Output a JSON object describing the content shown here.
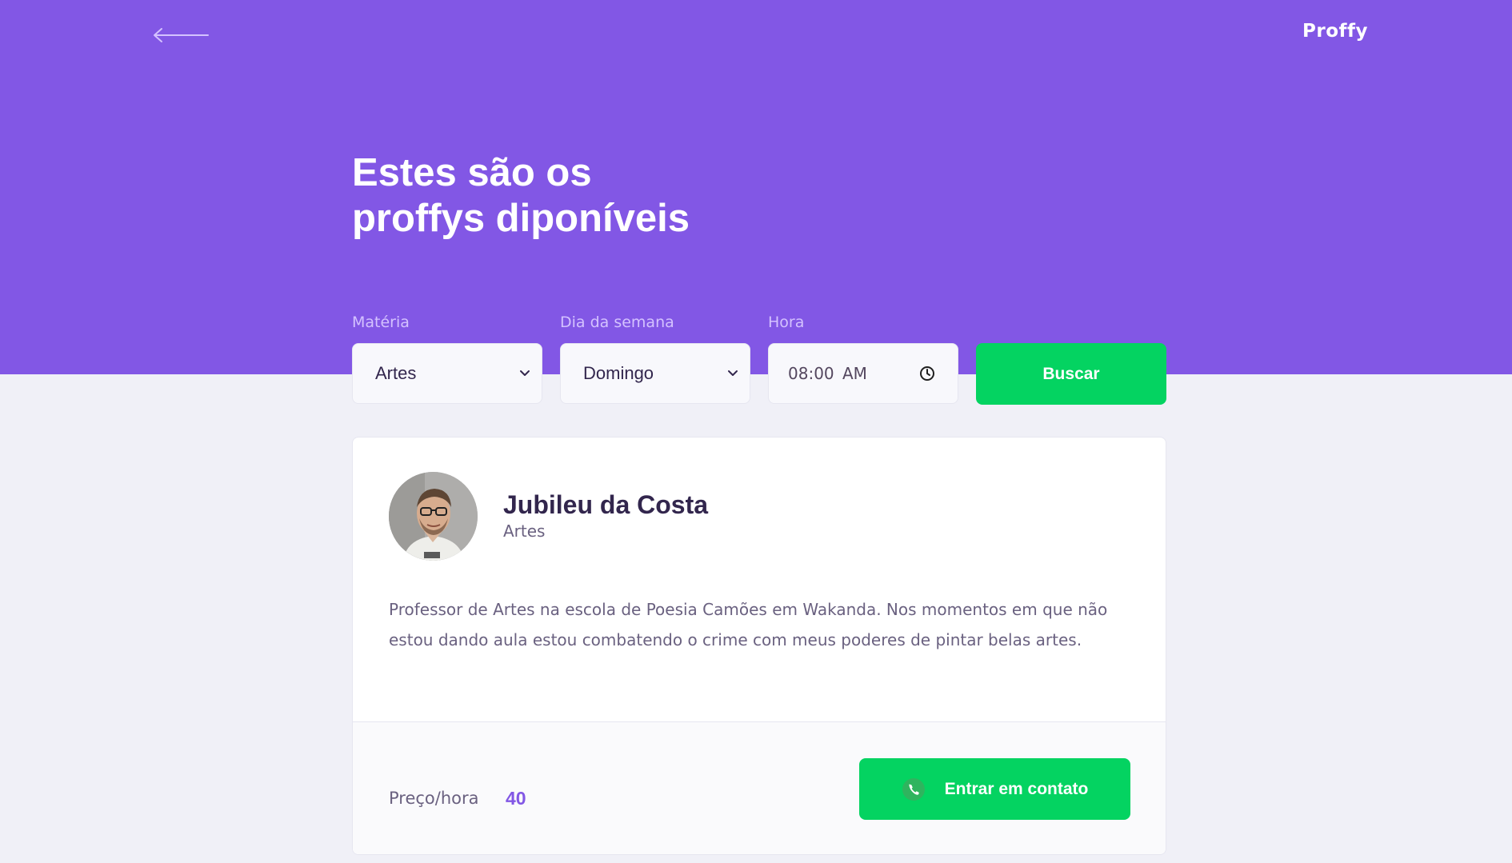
{
  "header": {
    "back_icon": "arrow-left-icon",
    "logo": "Proffy",
    "title_line1": "Estes são os",
    "title_line2": "proffys diponíveis",
    "color": "#8257e5"
  },
  "filters": {
    "subject": {
      "label": "Matéria",
      "value": "Artes",
      "icon": "chevron-down-icon"
    },
    "week_day": {
      "label": "Dia da semana",
      "value": "Domingo",
      "icon": "chevron-down-icon"
    },
    "time": {
      "label": "Hora",
      "value": "08:00 AM",
      "icon": "clock-icon"
    },
    "search_label": "Buscar"
  },
  "teacher": {
    "name": "Jubileu da Costa",
    "subject": "Artes",
    "bio": "Professor de Artes na escola de Poesia Camões em Wakanda. Nos momentos em que não estou dando aula estou combatendo o crime com meus poderes de pintar belas artes.",
    "price_label": "Preço/hora",
    "price": "40",
    "contact_label": "Entrar em contato",
    "contact_icon": "whatsapp-icon"
  },
  "colors": {
    "primary": "#8257e5",
    "secondary": "#04d361",
    "background": "#f0f0f7",
    "title_text": "#32264d",
    "body_text": "#6a6180"
  }
}
